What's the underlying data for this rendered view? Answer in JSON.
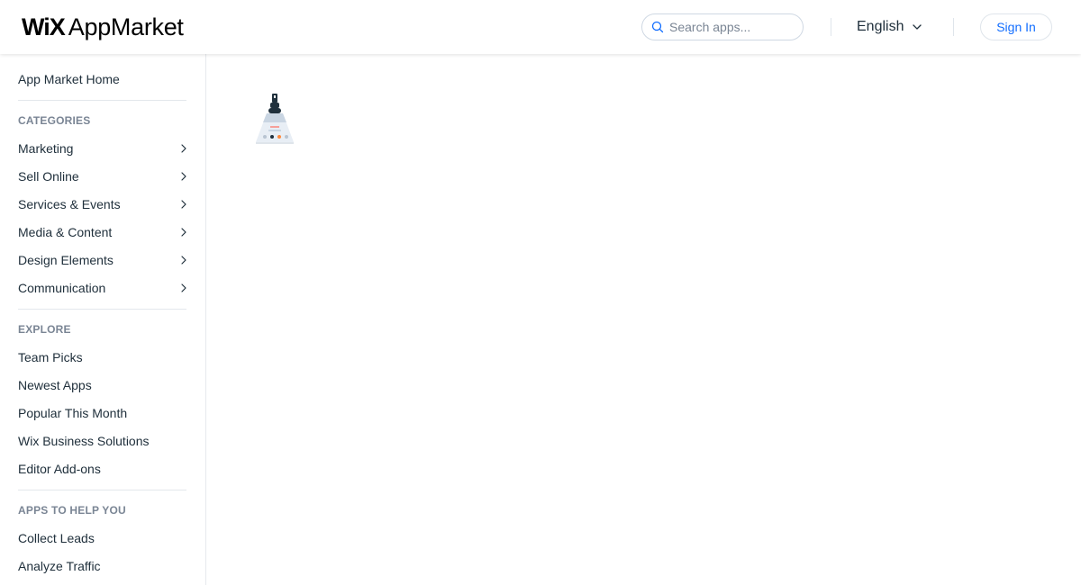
{
  "header": {
    "logo_brand": "WiX",
    "logo_product": "AppMarket",
    "search_placeholder": "Search apps...",
    "language": "English",
    "sign_in": "Sign In"
  },
  "sidebar": {
    "home": "App Market Home",
    "categories_title": "CATEGORIES",
    "categories": [
      {
        "label": "Marketing"
      },
      {
        "label": "Sell Online"
      },
      {
        "label": "Services & Events"
      },
      {
        "label": "Media & Content"
      },
      {
        "label": "Design Elements"
      },
      {
        "label": "Communication"
      }
    ],
    "explore_title": "EXPLORE",
    "explore": [
      {
        "label": "Team Picks"
      },
      {
        "label": "Newest Apps"
      },
      {
        "label": "Popular This Month"
      },
      {
        "label": "Wix Business Solutions"
      },
      {
        "label": "Editor Add-ons"
      }
    ],
    "help_title": "APPS TO HELP YOU",
    "help": [
      {
        "label": "Collect Leads"
      },
      {
        "label": "Analyze Traffic"
      }
    ]
  },
  "icons": {
    "search": "search-icon",
    "language_dropdown": "chevron-down-icon",
    "category_arrow": "chevron-right-icon",
    "loader": "loading-illustration-icon"
  },
  "colors": {
    "accent": "#116dff",
    "text": "#20303c",
    "muted": "#7a8594"
  }
}
